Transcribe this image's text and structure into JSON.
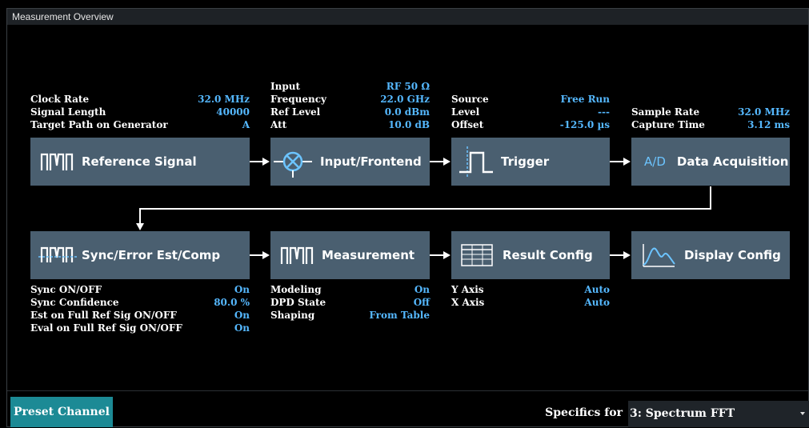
{
  "title": "Measurement Overview",
  "blocks": {
    "reference_signal": "Reference Signal",
    "input_frontend": "Input/Frontend",
    "trigger": "Trigger",
    "data_acquisition": "Data Acquisition",
    "data_acquisition_prefix": "A/D",
    "sync": "Sync/Error Est/Comp",
    "measurement": "Measurement",
    "result_config": "Result Config",
    "display_config": "Display Config"
  },
  "ref_params": [
    {
      "label": "Clock Rate",
      "value": "32.0 MHz"
    },
    {
      "label": "Signal Length",
      "value": "40000"
    },
    {
      "label": "Target Path on Generator",
      "value": "A"
    }
  ],
  "input_params": [
    {
      "label": "Input",
      "value": "RF 50 Ω"
    },
    {
      "label": "Frequency",
      "value": "22.0 GHz"
    },
    {
      "label": "Ref Level",
      "value": "0.0 dBm"
    },
    {
      "label": "Att",
      "value": "10.0 dB"
    }
  ],
  "trigger_params": [
    {
      "label": "Source",
      "value": "Free Run"
    },
    {
      "label": "Level",
      "value": "---"
    },
    {
      "label": "Offset",
      "value": "-125.0 µs"
    }
  ],
  "acq_params": [
    {
      "label": "Sample Rate",
      "value": "32.0 MHz"
    },
    {
      "label": "Capture Time",
      "value": "3.12 ms"
    }
  ],
  "sync_params": [
    {
      "label": "Sync ON/OFF",
      "value": "On"
    },
    {
      "label": "Sync Confidence",
      "value": "80.0 %"
    },
    {
      "label": "Est on Full Ref Sig ON/OFF",
      "value": "On"
    },
    {
      "label": "Eval on Full Ref Sig ON/OFF",
      "value": "On"
    }
  ],
  "meas_params": [
    {
      "label": "Modeling",
      "value": "On"
    },
    {
      "label": "DPD State",
      "value": "Off"
    },
    {
      "label": "Shaping",
      "value": "From Table"
    }
  ],
  "result_params": [
    {
      "label": "Y Axis",
      "value": "Auto"
    },
    {
      "label": "X Axis",
      "value": "Auto"
    }
  ],
  "footer": {
    "preset_label": "Preset Channel",
    "specifics_label": "Specifics for",
    "specifics_value": "3: Spectrum FFT"
  },
  "colors": {
    "block_bg": "#4a5f70",
    "value_text": "#55b8ff",
    "preset_bg": "#1c8a95"
  }
}
